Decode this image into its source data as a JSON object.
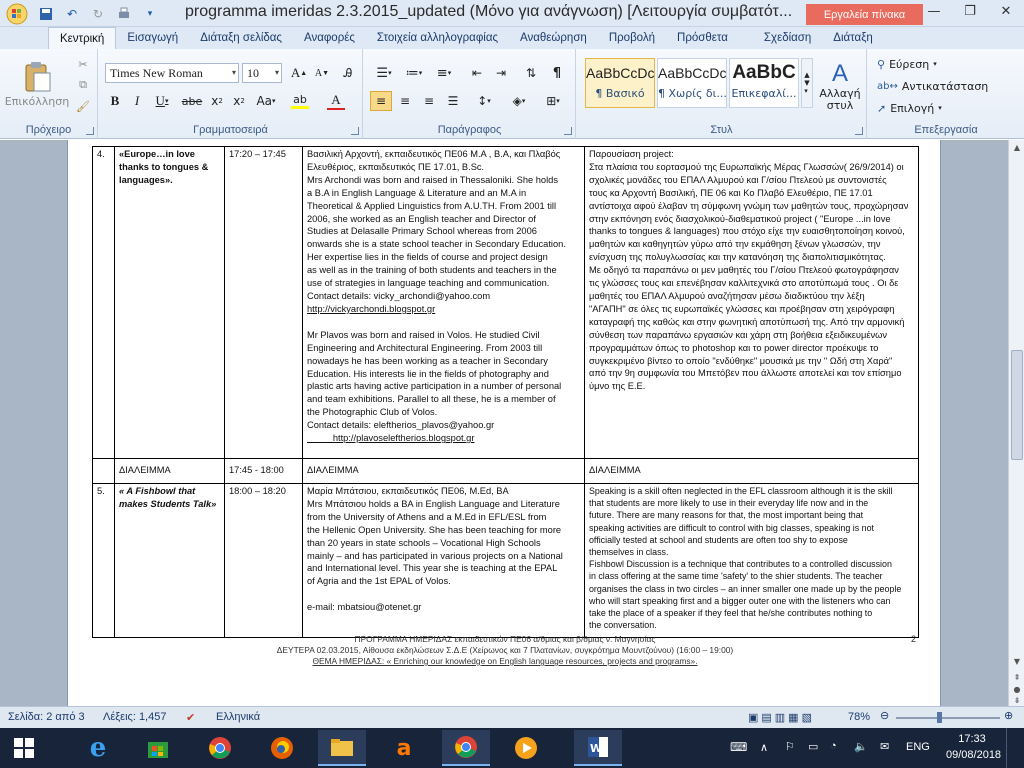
{
  "window": {
    "title": "programma imeridas 2.3.2015_updated (Μόνο για ανάγνωση) [Λειτουργία συμβατότ...",
    "context_tab": "Εργαλεία πίνακα"
  },
  "tabs": [
    "Κεντρική",
    "Εισαγωγή",
    "Διάταξη σελίδας",
    "Αναφορές",
    "Στοιχεία αλληλογραφίας",
    "Αναθεώρηση",
    "Προβολή",
    "Πρόσθετα",
    "Σχεδίαση",
    "Διάταξη"
  ],
  "ribbon": {
    "clipboard": {
      "paste": "Επικόλληση",
      "label": "Πρόχειρο"
    },
    "font": {
      "name": "Times New Roman",
      "size": "10",
      "label": "Γραμματοσειρά"
    },
    "paragraph": {
      "label": "Παράγραφος"
    },
    "styles": {
      "items": [
        {
          "sample": "AaBbCcDc",
          "name": "¶ Βασικό"
        },
        {
          "sample": "AaBbCcDc",
          "name": "¶ Χωρίς δι..."
        },
        {
          "sample": "AaBbC",
          "name": "Επικεφαλί..."
        }
      ],
      "change": "Αλλαγή στυλ",
      "label": "Στυλ"
    },
    "editing": {
      "find": "Εύρεση",
      "replace": "Αντικατάσταση",
      "select": "Επιλογή",
      "label": "Επεξεργασία"
    }
  },
  "document": {
    "row4": {
      "num": "4.",
      "title": "«Europe…in love thanks to tongues & languages».",
      "time": "17:20 – 17:45",
      "speakers_lines": [
        "Βασιλική Αρχοντή,  εκπαιδευτικός ΠΕ06 Μ.Α , Β.Α, και Πλαβός",
        "Ελευθέριος,  εκπαιδευτικός ΠΕ 17.01, B.Sc.",
        "Mrs Archondi  was born and raised in Thessaloniki. She holds",
        "a B.A in English Language & Literature and an M.A in",
        "Theoretical & Applied Linguistics from A.U.TH. From 2001 till",
        "2006, she worked  as an English teacher and Director of",
        "Studies at Delasalle Primary School whereas  from 2006",
        "onwards she is a state school teacher in Secondary Education.",
        "Her expertise  lies in the fields of course and project design",
        "as well as in the training of both students  and teachers in the",
        "use of strategies  in language teaching and communication.",
        "Contact details: vicky_archondi@yahoo.com",
        "http://vickyarchondi.blogspot.gr",
        "",
        "Mr Plavos was born and raised in Volos. He studied  Civil",
        "Engineering and Architectural Engineering. From 2003 till",
        "nowadays he has been working as a teacher in Secondary",
        "Education. His interests  lie in the fields of photography and",
        "plastic arts having active participation in a number of personal",
        "and team exhibitions. Parallel to all these, he is a member of",
        "the Photographic Club of Volos.",
        "Contact details: eleftherios_plavos@yahoo.gr",
        "          http://plavoseleftherios.blogspot.gr"
      ],
      "desc_lines": [
        "Παρουσίαση project:",
        "Στα πλαίσια του εορτασμού της Ευρωπαϊκής Μέρας Γλωσσών( 26/9/2014) οι",
        "σχολικές μονάδες του ΕΠΑΛ  Αλμυρού και Γ/σίου Πτελεού  με συντονιστές",
        "τους  κα Αρχοντή Βασιλική, ΠΕ 06 και Κο Πλαβό Ελευθέριο, ΠΕ 17.01",
        "αντίστοιχα αφού έλαβαν τη σύμφωνη γνώμη των μαθητών τους, προχώρησαν",
        "στην εκπόνηση ενός διασχολικού-διαθεματικού project ( \"Europe ...in love",
        "thanks to tongues & languages) που στόχο είχε  την ευαισθητοποίηση κοινού,",
        "μαθητών και καθηγητών γύρω από την εκμάθηση ξένων γλωσσών, την",
        "ενίσχυση της πολυγλωσσίας και την κατανόηση της διαπολιτισμικότητας.",
        "Με οδηγό τα παραπάνω οι μεν μαθητές του Γ/σίου Πτελεού  φωτογράφησαν",
        "τις γλώσσες  τους και επενέβησαν  καλλιτεχνικά  στο αποτύπωμά τους . Οι δε",
        "μαθητές του ΕΠΑΛ  Αλμυρού αναζήτησαν μέσω διαδικτύου  την λέξη",
        "\"ΑΓΑΠΗ\" σε όλες τις ευρωπαϊκές  γλώσσες  και προέβησαν στη χειρόγραφη",
        "καταγραφή της καθώς και στην φωνητική αποτύπωσή της.  Από την αρμονική",
        "σύνθεση των παραπάνω εργασιών και χάρη στη βοήθεια εξειδικευμένων",
        "προγραμμάτων όπως το photoshop και το power director  προέκυψε το",
        "συγκεκριμένο βίντεο το οποίο \"ενδύθηκε\" μουσικά με την \" Ωδή στη Χαρά\"",
        "από την 9η συμφωνία του Μπετόβεν που άλλωστε αποτελεί και τον επίσημο",
        "ύμνο της Ε.Ε."
      ]
    },
    "break_row": {
      "title": "ΔΙΑΛΕΙΜΜΑ",
      "time": "17:45 - 18:00",
      "col3": "ΔΙΑΛΕΙΜΜΑ",
      "col4": "ΔΙΑΛΕΙΜΜΑ"
    },
    "row5": {
      "num": "5.",
      "title": "« A Fishbowl that makes Students  Talk»",
      "time": "18:00 – 18:20",
      "speakers_lines": [
        "Μαρία Μπάτσιου, εκπαιδευτικός ΠΕ06, M.Ed, BA",
        "Mrs Μπάτσιου holds a BA in English Language and Literature",
        "from the University of Athens and a M.Ed in EFL/ESL from",
        "the Hellenic Open University. She has been teaching for more",
        "than 20 years in state  schools – Vocational High Schools",
        "mainly – and has participated in various projects on a National",
        "and International level. This year she is teaching at the EPAL",
        "of Agria and the 1st EPAL of Volos.",
        "",
        "e-mail: mbatsiou@otenet.gr"
      ],
      "desc_lines": [
        "Speaking is a skill often neglected in the EFL classroom although it is the skill",
        "that students are more likely to use in their everyday life now and in the",
        "future. There are many reasons for that, the most important being that",
        "speaking activities are difficult to control with big classes, speaking is not",
        "officially tested at school and students are often too shy to expose",
        "themselves in class.",
        "Fishbowl Discussion is a technique that contributes to a controlled discussion",
        "in class offering at the same time 'safety' to the shier students. The teacher",
        "organises the class in two circles – an inner smaller one made up by the people",
        "who will start speaking first and a bigger outer one with the listeners who can",
        "take the place of a speaker if they feel that he/she contributes nothing to",
        "the conversation."
      ]
    },
    "footer": {
      "line1": "ΠΡΟΓΡΑΜΜΑ ΗΜΕΡΙΔΑΣ εκπαιδευτικών  ΠΕ06 α/θμιας  και β/θμιας ν. Μαγνησίας",
      "line2": "ΔΕΥΤΕΡΑ 02.03.2015,  Αίθουσα εκδηλώσεων Σ.Δ.Ε (Χείρωνος και 7 Πλατανίων, συγκρότημα Μουντζούνου) (16:00 – 19:00)",
      "line3": "ΘΕΜΑ ΗΜΕΡΙΔΑΣ: « Enriching our knowledge on English language resources, projects and programs».",
      "page_number": "2"
    }
  },
  "statusbar": {
    "page": "Σελίδα: 2 από 3",
    "words": "Λέξεις: 1,457",
    "language": "Ελληνικά",
    "zoom": "78%"
  },
  "taskbar": {
    "lang": "ENG",
    "time": "17:33",
    "date": "09/08/2018"
  }
}
